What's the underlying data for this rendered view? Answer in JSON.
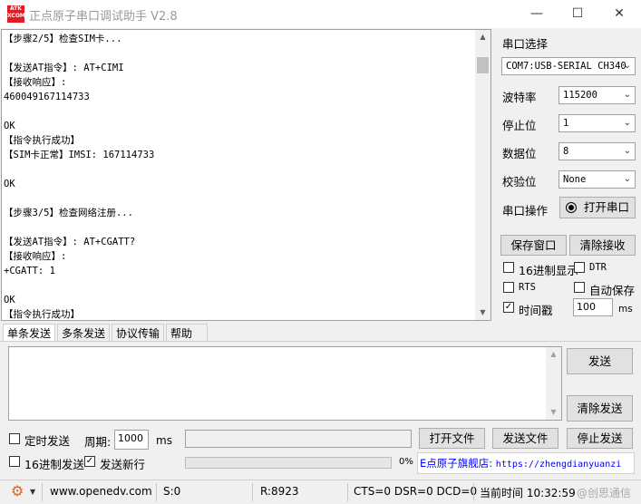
{
  "app": {
    "title": "正点原子串口调试助手 V2.8",
    "logo_text": "ATK XCOM"
  },
  "window_controls": {
    "minimize": "—",
    "maximize": "☐",
    "close": "✕"
  },
  "receive": {
    "lines": [
      "【步骤2/5】检查SIM卡...",
      "",
      "【发送AT指令】: AT+CIMI",
      "【接收响应】:",
      "460049167114733",
      "",
      "OK",
      "【指令执行成功】",
      "【SIM卡正常】IMSI: 167114733",
      "",
      "OK",
      "",
      "【步骤3/5】检查网络注册...",
      "",
      "【发送AT指令】: AT+CGATT?",
      "【接收响应】:",
      "+CGATT: 1",
      "",
      "OK",
      "【指令执行成功】"
    ]
  },
  "serial": {
    "section_label": "串口选择",
    "port": "COM7:USB-SERIAL CH340",
    "baud_label": "波特率",
    "baud": "115200",
    "stop_label": "停止位",
    "stop": "1",
    "data_label": "数据位",
    "data": "8",
    "parity_label": "校验位",
    "parity": "None",
    "op_label": "串口操作",
    "open_button": "打开串口"
  },
  "actions": {
    "save_window": "保存窗口",
    "clear_receive": "清除接收",
    "hex_display": "16进制显示",
    "dtr": "DTR",
    "rts": "RTS",
    "auto_save": "自动保存",
    "timestamp": "时间戳",
    "timestamp_value": "100",
    "timestamp_unit": "ms"
  },
  "checkbox_states": {
    "hex_display": false,
    "dtr": false,
    "rts": false,
    "auto_save": false,
    "timestamp": true,
    "timed_send": false,
    "hex_send": false,
    "send_newline": true
  },
  "tabs": [
    "单条发送",
    "多条发送",
    "协议传输",
    "帮助"
  ],
  "send": {
    "send_button": "发送",
    "clear_send_button": "清除发送",
    "timed_send": "定时发送",
    "period_label": "周期:",
    "period_value": "1000",
    "period_unit": "ms",
    "open_file": "打开文件",
    "send_file": "发送文件",
    "stop_send": "停止发送",
    "hex_send": "16进制发送",
    "send_newline": "发送新行",
    "progress_percent": "0%",
    "promo_prefix": "E点原子旗舰店:",
    "promo_url": "https://zhengdianyuanzi"
  },
  "statusbar": {
    "website": "www.openedv.com",
    "s": "S:0",
    "r": "R:8923",
    "lines": "CTS=0 DSR=0 DCD=0",
    "time_label": "当前时间 10:32:59",
    "watermark": "@创思通信"
  },
  "colors": {
    "promo_blue": "#0000ff",
    "logo_red": "#e31c23",
    "gear_orange": "#e8601c"
  }
}
